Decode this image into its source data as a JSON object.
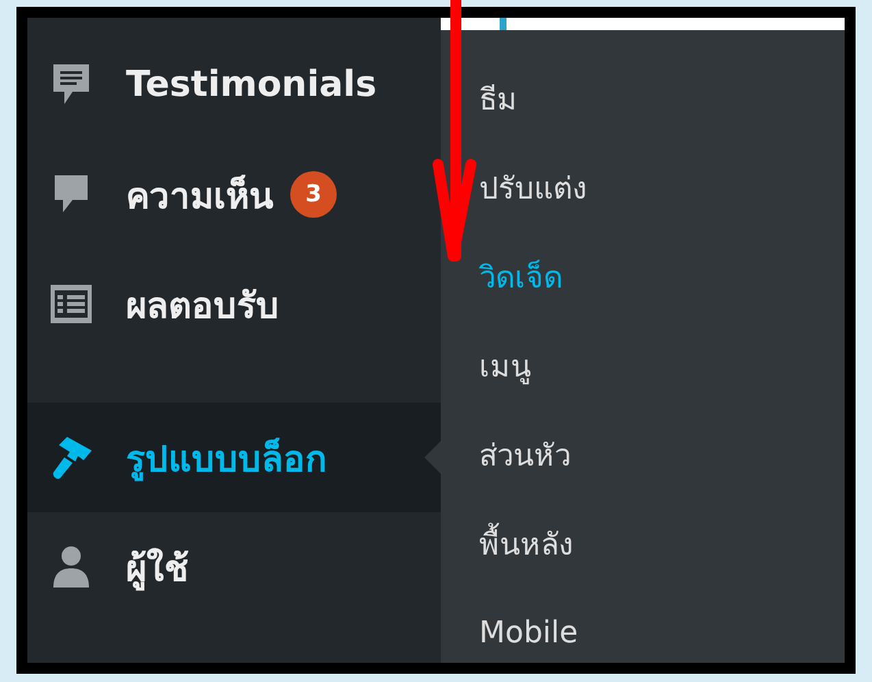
{
  "sidebar": {
    "items": [
      {
        "label": "Testimonials",
        "selected": false
      },
      {
        "label": "ความเห็น",
        "selected": false,
        "badge": "3"
      },
      {
        "label": "ผลตอบรับ",
        "selected": false
      },
      {
        "label": "รูปแบบบล็อก",
        "selected": true
      },
      {
        "label": "ผู้ใช้",
        "selected": false
      }
    ]
  },
  "submenu": {
    "items": [
      {
        "label": "ธีม",
        "selected": false
      },
      {
        "label": "ปรับแต่ง",
        "selected": false
      },
      {
        "label": "วิดเจ็ด",
        "selected": true
      },
      {
        "label": "เมนู",
        "selected": false
      },
      {
        "label": "ส่วนหัว",
        "selected": false
      },
      {
        "label": "พื้นหลัง",
        "selected": false
      },
      {
        "label": "Mobile",
        "selected": false
      }
    ]
  }
}
